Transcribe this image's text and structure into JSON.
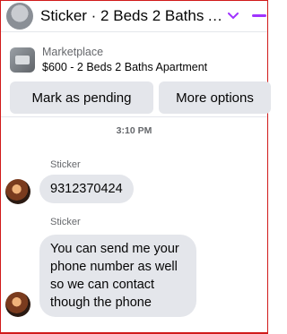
{
  "header": {
    "title": "Sticker · 2 Beds 2 Baths Ap...",
    "icons": [
      "chevron-down-icon",
      "minimize-icon"
    ],
    "accent": "#a033ff"
  },
  "marketplace": {
    "label": "Marketplace",
    "listing": "$600 - 2 Beds 2 Baths Apartment",
    "buttons": {
      "pending": "Mark as pending",
      "more": "More options"
    }
  },
  "chat": {
    "timestamp": "3:10 PM",
    "messages": [
      {
        "sender": "Sticker",
        "text": "9312370424"
      },
      {
        "sender": "Sticker",
        "text": "You can send me your phone number as well so we can contact though the phone"
      }
    ]
  }
}
